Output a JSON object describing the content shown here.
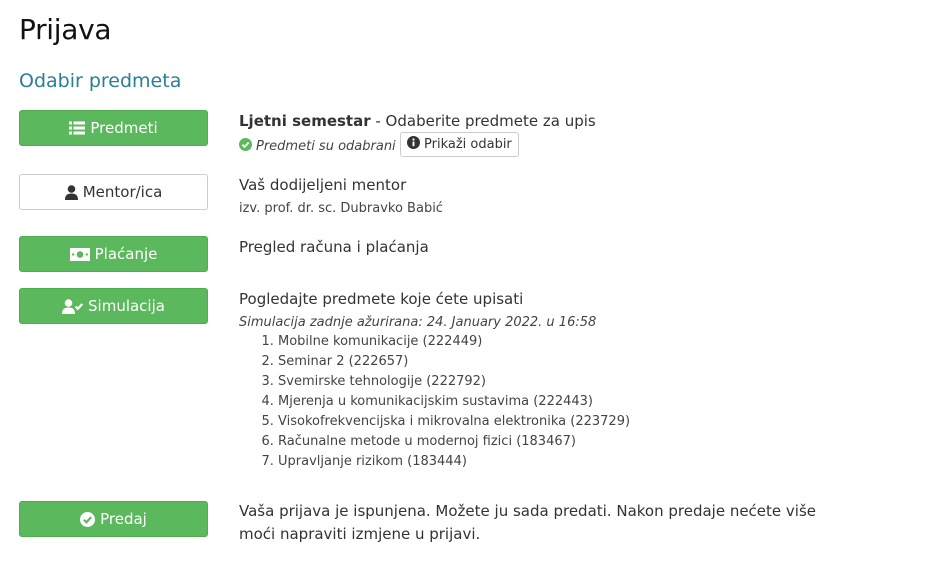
{
  "page": {
    "title": "Prijava",
    "section_title": "Odabir predmeta"
  },
  "colors": {
    "accent_green": "#5cb85c",
    "section_title": "#2a7f96"
  },
  "predmeti": {
    "button_label": "Predmeti",
    "button_icon": "list-icon",
    "heading_bold": "Ljetni semestar",
    "heading_rest": " - Odaberite predmete za upis",
    "status_icon": "check-circle-icon",
    "status_text": "Predmeti su odabrani",
    "show_button_icon": "info-circle-icon",
    "show_button_label": "Prikaži odabir"
  },
  "mentor": {
    "button_label": "Mentor/ica",
    "button_icon": "user-icon",
    "heading": "Vaš dodijeljeni mentor",
    "name": "izv. prof. dr. sc. Dubravko Babić"
  },
  "placanje": {
    "button_label": "Plaćanje",
    "button_icon": "money-icon",
    "heading": "Pregled računa i plaćanja"
  },
  "simulacija": {
    "button_label": "Simulacija",
    "button_icon": "user-check-icon",
    "heading": "Pogledajte predmete koje ćete upisati",
    "updated": "Simulacija zadnje ažurirana: 24. January 2022. u 16:58",
    "subjects": [
      "Mobilne komunikacije (222449)",
      "Seminar 2 (222657)",
      "Svemirske tehnologije (222792)",
      "Mjerenja u komunikacijskim sustavima (222443)",
      "Visokofrekvencijska i mikrovalna elektronika (223729)",
      "Računalne metode u modernoj fizici (183467)",
      "Upravljanje rizikom (183444)"
    ]
  },
  "predaj": {
    "button_label": "Predaj",
    "button_icon": "check-circle-icon",
    "message": "Vaša prijava je ispunjena. Možete ju sada predati. Nakon predaje nećete više moći napraviti izmjene u prijavi."
  }
}
